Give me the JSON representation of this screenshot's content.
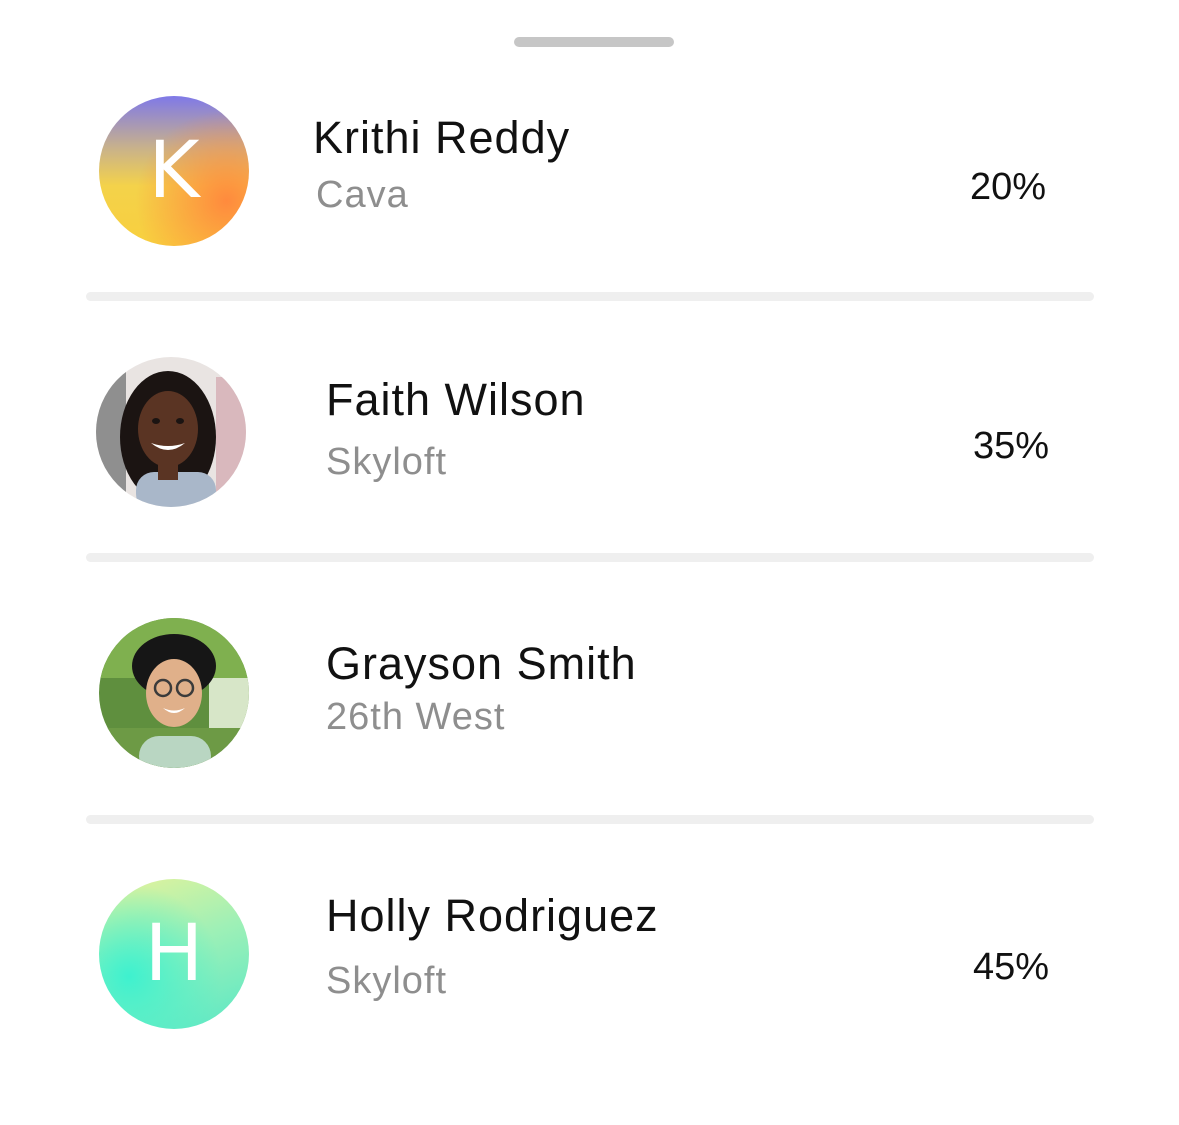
{
  "people": [
    {
      "name": "Krithi Reddy",
      "company": "Cava",
      "percent": "20%",
      "avatar": {
        "type": "initial",
        "initial": "K",
        "colors": [
          "#7f79e8",
          "#f4d24a",
          "#ff8a3d"
        ]
      }
    },
    {
      "name": "Faith Wilson",
      "company": "Skyloft",
      "percent": "35%",
      "avatar": {
        "type": "photo",
        "icon": "person-photo"
      }
    },
    {
      "name": "Grayson Smith",
      "company": "26th West",
      "percent": "",
      "avatar": {
        "type": "photo",
        "icon": "person-photo"
      }
    },
    {
      "name": "Holly Rodriguez",
      "company": "Skyloft",
      "percent": "45%",
      "avatar": {
        "type": "initial",
        "initial": "H",
        "colors": [
          "#e6f39a",
          "#59e8c6",
          "#3ef1cf"
        ]
      }
    }
  ]
}
